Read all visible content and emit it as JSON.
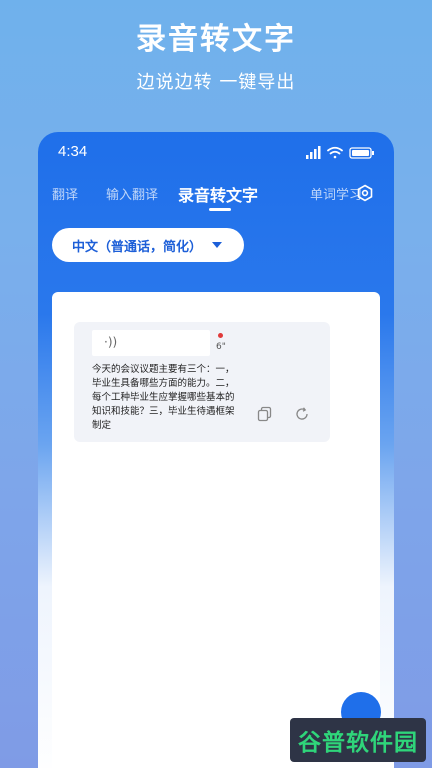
{
  "promo": {
    "title": "录音转文字",
    "subtitle": "边说边转 一键导出"
  },
  "status_bar": {
    "time": "4:34",
    "icons": [
      "signal-icon",
      "wifi-icon",
      "battery-icon"
    ]
  },
  "tabs": [
    {
      "label": "翻译",
      "active": false
    },
    {
      "label": "输入翻译",
      "active": false
    },
    {
      "label": "录音转文字",
      "active": true
    },
    {
      "label": "单词学习",
      "active": false
    }
  ],
  "language_selector": {
    "selected": "中文（普通话，简化）",
    "icon": "caret-down-icon"
  },
  "transcript": {
    "audio_indicator": "·))",
    "duration": "6\"",
    "text": "今天的会议议题主要有三个：一，毕业生具备哪些方面的能力。二，每个工种毕业生应掌握哪些基本的知识和技能？三，毕业生待遇框架制定",
    "actions": [
      "copy-icon",
      "retry-icon"
    ]
  },
  "watermark": {
    "text": "谷普软件园"
  },
  "colors": {
    "accent": "#1f6fea",
    "text_accent": "#1d5fd8",
    "recording": "#e03a3a",
    "watermark_green": "#2fd57a"
  }
}
